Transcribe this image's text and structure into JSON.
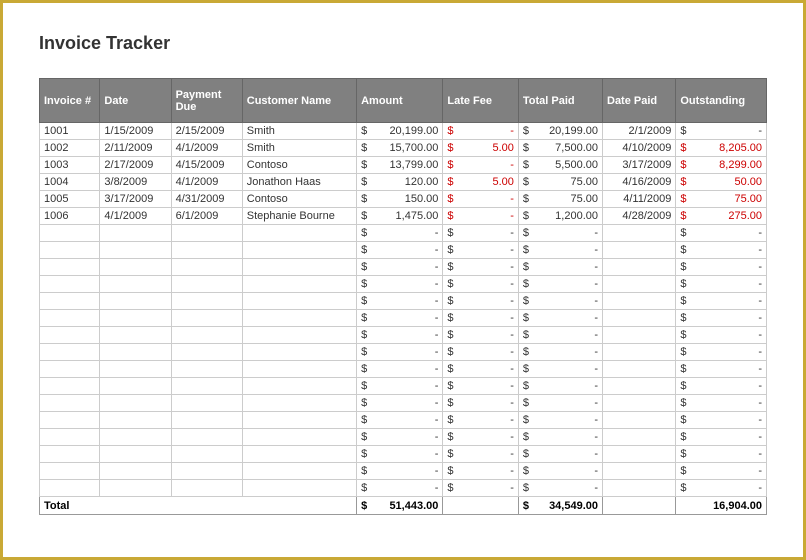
{
  "title": "Invoice Tracker",
  "headers": {
    "invoice": "Invoice #",
    "date": "Date",
    "paymentDue": "Payment Due",
    "customerName": "Customer Name",
    "amount": "Amount",
    "lateFee": "Late Fee",
    "totalPaid": "Total Paid",
    "datePaid": "Date Paid",
    "outstanding": "Outstanding"
  },
  "rows": [
    {
      "invoice": "1001",
      "date": "1/15/2009",
      "due": "2/15/2009",
      "customer": "Smith",
      "amount": "20,199.00",
      "lateFee": "-",
      "totalPaid": "20,199.00",
      "datePaid": "2/1/2009",
      "outstanding": "-"
    },
    {
      "invoice": "1002",
      "date": "2/11/2009",
      "due": "4/1/2009",
      "customer": "Smith",
      "amount": "15,700.00",
      "lateFee": "5.00",
      "totalPaid": "7,500.00",
      "datePaid": "4/10/2009",
      "outstanding": "8,205.00"
    },
    {
      "invoice": "1003",
      "date": "2/17/2009",
      "due": "4/15/2009",
      "customer": "Contoso",
      "amount": "13,799.00",
      "lateFee": "-",
      "totalPaid": "5,500.00",
      "datePaid": "3/17/2009",
      "outstanding": "8,299.00"
    },
    {
      "invoice": "1004",
      "date": "3/8/2009",
      "due": "4/1/2009",
      "customer": "Jonathon Haas",
      "amount": "120.00",
      "lateFee": "5.00",
      "totalPaid": "75.00",
      "datePaid": "4/16/2009",
      "outstanding": "50.00"
    },
    {
      "invoice": "1005",
      "date": "3/17/2009",
      "due": "4/31/2009",
      "customer": "Contoso",
      "amount": "150.00",
      "lateFee": "-",
      "totalPaid": "75.00",
      "datePaid": "4/11/2009",
      "outstanding": "75.00"
    },
    {
      "invoice": "1006",
      "date": "4/1/2009",
      "due": "6/1/2009",
      "customer": "Stephanie Bourne",
      "amount": "1,475.00",
      "lateFee": "-",
      "totalPaid": "1,200.00",
      "datePaid": "4/28/2009",
      "outstanding": "275.00"
    }
  ],
  "emptyRowCount": 16,
  "totals": {
    "label": "Total",
    "amount": "51,443.00",
    "totalPaid": "34,549.00",
    "outstanding": "16,904.00"
  },
  "currencySymbol": "$",
  "dash": "-"
}
